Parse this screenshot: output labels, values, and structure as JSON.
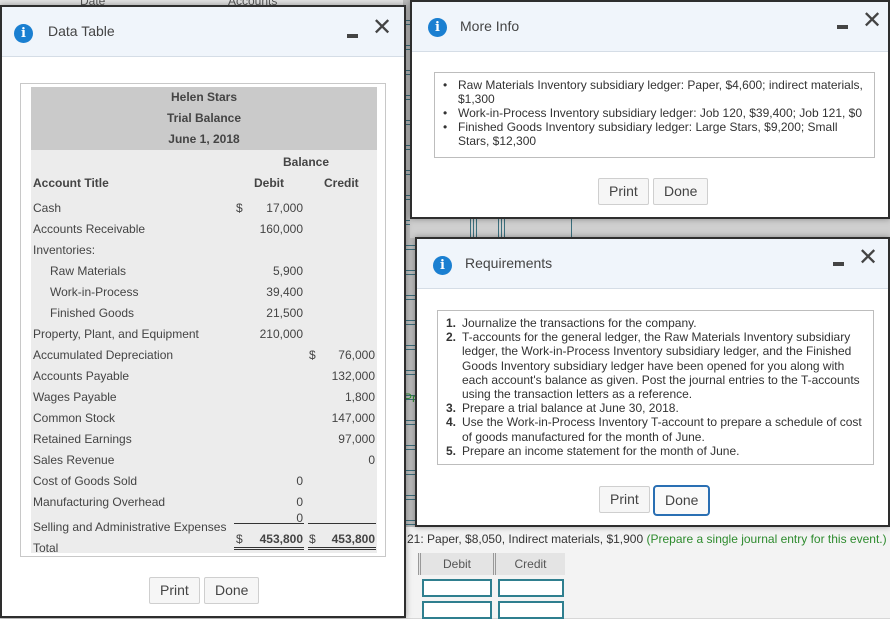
{
  "background": {
    "header_date": "Date",
    "header_accounts": "Accounts",
    "instruction_text": "21: Paper, $8,050, Indirect materials, $1,900",
    "instruction_hint": "(Prepare a single journal entry for this event.)",
    "partial_hint": "Pre",
    "journal_columns": [
      "Debit",
      "Credit"
    ]
  },
  "data_table_dialog": {
    "title": "Data Table",
    "company": "Helen Stars",
    "statement": "Trial Balance",
    "date": "June 1, 2018",
    "balance_header": "Balance",
    "col_account": "Account Title",
    "col_debit": "Debit",
    "col_credit": "Credit",
    "rows": [
      {
        "account": "Cash",
        "debit_sign": "$",
        "debit": "17,000",
        "credit_sign": "",
        "credit": ""
      },
      {
        "account": "Accounts Receivable",
        "debit_sign": "",
        "debit": "160,000",
        "credit_sign": "",
        "credit": ""
      },
      {
        "account": "Inventories:",
        "debit_sign": "",
        "debit": "",
        "credit_sign": "",
        "credit": ""
      },
      {
        "account": "Raw Materials",
        "debit_sign": "",
        "debit": "5,900",
        "credit_sign": "",
        "credit": "",
        "indent": true
      },
      {
        "account": "Work-in-Process",
        "debit_sign": "",
        "debit": "39,400",
        "credit_sign": "",
        "credit": "",
        "indent": true
      },
      {
        "account": "Finished Goods",
        "debit_sign": "",
        "debit": "21,500",
        "credit_sign": "",
        "credit": "",
        "indent": true
      },
      {
        "account": "Property, Plant, and Equipment",
        "debit_sign": "",
        "debit": "210,000",
        "credit_sign": "",
        "credit": ""
      },
      {
        "account": "Accumulated Depreciation",
        "debit_sign": "",
        "debit": "",
        "credit_sign": "$",
        "credit": "76,000"
      },
      {
        "account": "Accounts Payable",
        "debit_sign": "",
        "debit": "",
        "credit_sign": "",
        "credit": "132,000"
      },
      {
        "account": "Wages Payable",
        "debit_sign": "",
        "debit": "",
        "credit_sign": "",
        "credit": "1,800"
      },
      {
        "account": "Common Stock",
        "debit_sign": "",
        "debit": "",
        "credit_sign": "",
        "credit": "147,000"
      },
      {
        "account": "Retained Earnings",
        "debit_sign": "",
        "debit": "",
        "credit_sign": "",
        "credit": "97,000"
      },
      {
        "account": "Sales Revenue",
        "debit_sign": "",
        "debit": "",
        "credit_sign": "",
        "credit": "0"
      },
      {
        "account": "Cost of Goods Sold",
        "debit_sign": "",
        "debit": "0",
        "credit_sign": "",
        "credit": ""
      },
      {
        "account": "Manufacturing Overhead",
        "debit_sign": "",
        "debit": "0",
        "credit_sign": "",
        "credit": ""
      },
      {
        "account": "Selling and Administrative Expenses",
        "debit_sign": "",
        "debit": "0",
        "credit_sign": "",
        "credit": ""
      }
    ],
    "total": {
      "account": "Total",
      "debit_sign": "$",
      "debit": "453,800",
      "credit_sign": "$",
      "credit": "453,800"
    },
    "print_label": "Print",
    "done_label": "Done"
  },
  "more_info_dialog": {
    "title": "More Info",
    "items": [
      "Raw Materials Inventory subsidiary ledger: Paper, $4,600; indirect materials, $1,300",
      "Work-in-Process Inventory subsidiary ledger: Job 120, $39,400; Job 121, $0",
      "Finished Goods Inventory subsidiary ledger: Large Stars, $9,200; Small Stars, $12,300"
    ],
    "print_label": "Print",
    "done_label": "Done"
  },
  "requirements_dialog": {
    "title": "Requirements",
    "items": [
      {
        "num": "1.",
        "text": "Journalize the transactions for the company."
      },
      {
        "num": "2.",
        "text": "T-accounts for the general ledger, the Raw Materials Inventory subsidiary ledger, the Work-in-Process Inventory subsidiary ledger, and the Finished Goods Inventory subsidiary ledger have been opened for you along with each account's balance as given. Post the journal entries to the T-accounts using the transaction letters as a reference."
      },
      {
        "num": "3.",
        "text": "Prepare a trial balance at June 30, 2018."
      },
      {
        "num": "4.",
        "text": "Use the Work-in-Process Inventory T-account to prepare a schedule of cost of goods manufactured for the month of June."
      },
      {
        "num": "5.",
        "text": "Prepare an income statement for the month of June."
      }
    ],
    "print_label": "Print",
    "done_label": "Done"
  },
  "icons": {
    "info": "i",
    "close": "✕"
  },
  "colors": {
    "info_icon": "#1a7fd1",
    "hint_green": "#2e8b2e",
    "focus_border": "#2a6fb3",
    "input_border": "#2f7f8f"
  }
}
